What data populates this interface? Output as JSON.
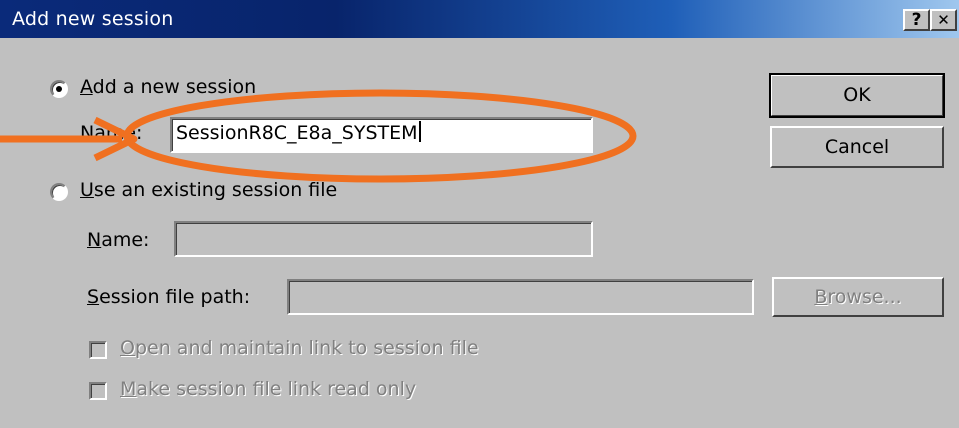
{
  "window": {
    "title": "Add new session",
    "help_label": "?",
    "close_label": "✕"
  },
  "new_session": {
    "radio_label": "Add a new session",
    "selected": true,
    "name_label": "Name:",
    "name_value": "SessionR8C_E8a_SYSTEM"
  },
  "existing_session": {
    "radio_label": "Use an existing session file",
    "selected": false,
    "name_label": "Name:",
    "name_value": "",
    "path_label": "Session file path:",
    "path_value": "",
    "browse_label": "Browse..."
  },
  "options": {
    "open_link_label": "Open and maintain link to session file",
    "read_only_label": "Make session file link read only"
  },
  "buttons": {
    "ok_label": "OK",
    "cancel_label": "Cancel"
  },
  "annotation": {
    "color": "#f07020"
  }
}
